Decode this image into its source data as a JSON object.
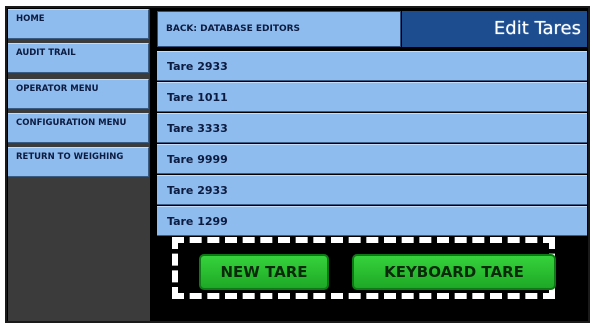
{
  "sidebar": {
    "items": [
      {
        "label": "HOME"
      },
      {
        "label": "AUDIT TRAIL"
      },
      {
        "label": "OPERATOR MENU"
      },
      {
        "label": "CONFIGURATION MENU"
      },
      {
        "label": "RETURN TO WEIGHING"
      }
    ]
  },
  "header": {
    "back_label": "BACK: DATABASE EDITORS",
    "title": "Edit Tares"
  },
  "tares": [
    {
      "label": "Tare 2933"
    },
    {
      "label": "Tare 1011"
    },
    {
      "label": "Tare 3333"
    },
    {
      "label": "Tare 9999"
    },
    {
      "label": "Tare 2933"
    },
    {
      "label": "Tare 1299"
    }
  ],
  "actions": {
    "new_tare_label": "NEW TARE",
    "keyboard_tare_label": "KEYBOARD TARE"
  },
  "colors": {
    "button_blue": "#8fbcee",
    "title_blue": "#1e4d8f",
    "action_green": "#2ec734",
    "background": "#000000",
    "sidebar_gray": "#3b3b3b"
  }
}
